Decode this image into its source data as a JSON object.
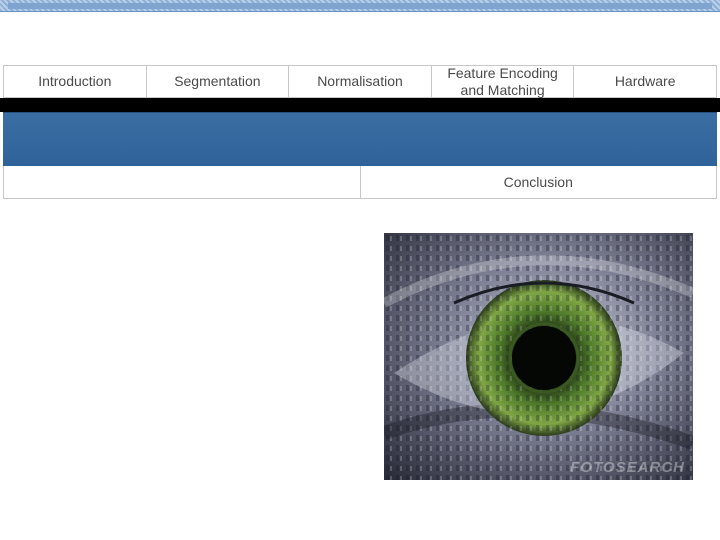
{
  "nav": {
    "tabs": [
      {
        "label": "Introduction"
      },
      {
        "label": "Segmentation"
      },
      {
        "label": "Normalisation"
      },
      {
        "label": "Feature Encoding and Matching"
      },
      {
        "label": "Hardware"
      }
    ]
  },
  "subnav": {
    "left_label": "",
    "right_label": "Conclusion"
  },
  "image": {
    "watermark": "FOTOSEARCH"
  },
  "colors": {
    "accent_blue": "#2e6299",
    "iris_green": "#6f9a3a"
  }
}
